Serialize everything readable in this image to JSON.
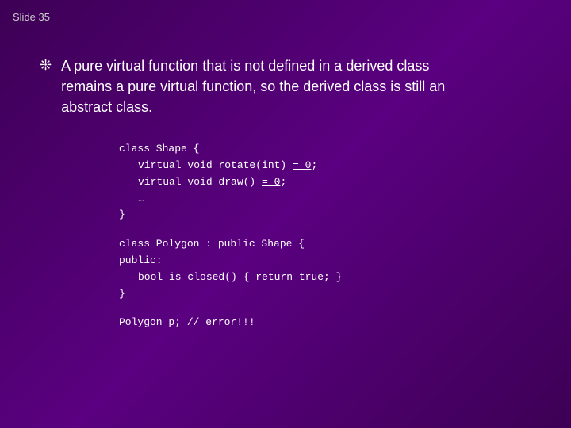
{
  "slide": {
    "label": "Slide 35",
    "bullet": {
      "symbol": "❊",
      "text_line1": "A pure virtual function that is not defined in a derived class",
      "text_line2": "remains a pure virtual function, so the derived class is still an",
      "text_line3": "abstract class."
    },
    "code": {
      "class_shape_open": "class Shape {",
      "rotate_line": "    virtual void rotate(int) = 0;",
      "draw_line": "    virtual void draw() = 0;",
      "ellipsis": "    …",
      "class_shape_close": "}",
      "blank": "",
      "class_polygon_open": "class Polygon : public Shape {",
      "public_label": "public:",
      "is_closed_line": "    bool is_closed() { return true; }",
      "class_polygon_close": "}",
      "blank2": "",
      "polygon_error": "Polygon p; // error!!!"
    }
  }
}
